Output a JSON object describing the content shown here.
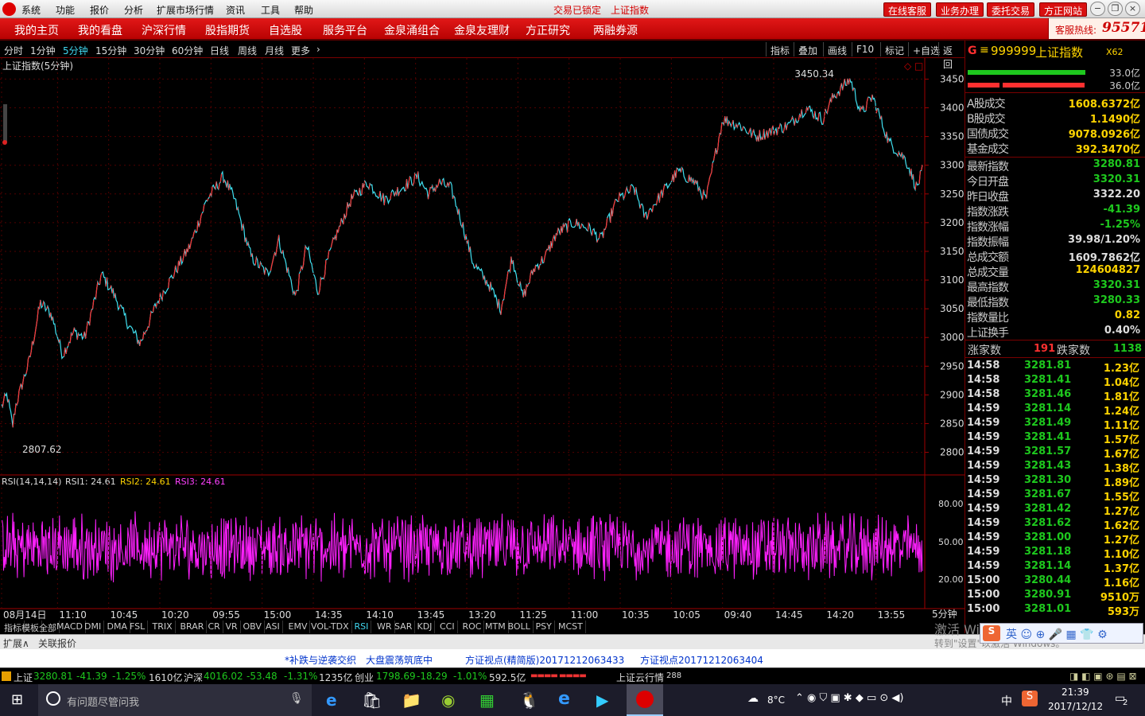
{
  "titlebar": {
    "menus": [
      "系统",
      "功能",
      "报价",
      "分析",
      "扩展市场行情",
      "资讯",
      "工具",
      "帮助"
    ],
    "trade_status": "交易已锁定",
    "index_name": "上证指数",
    "buttons": [
      "在线客服",
      "业务办理",
      "委托交易",
      "方正网站"
    ]
  },
  "nav": {
    "items": [
      "我的主页",
      "我的看盘",
      "沪深行情",
      "股指期货",
      "自选股",
      "服务平台",
      "金泉涌组合",
      "金泉友理财",
      "方正研究",
      "两融券源"
    ],
    "hotline_label": "客服热线:",
    "hotline_number": "95571"
  },
  "period": {
    "items": [
      "分时",
      "1分钟",
      "5分钟",
      "15分钟",
      "30分钟",
      "60分钟",
      "日线",
      "周线",
      "月线",
      "更多"
    ],
    "active": "5分钟",
    "tools": [
      "指标",
      "叠加",
      "画线",
      "F10",
      "标记",
      "+自选",
      "返回"
    ]
  },
  "chart": {
    "title": "上证指数(5分钟)",
    "high_label": "3450.34",
    "low_label": "2807.62",
    "accent_up": "#ff3030",
    "accent_line": "#40e0f0"
  },
  "chart_data": {
    "type": "line",
    "title": "上证指数(5分钟)",
    "ylim": [
      2780,
      3470
    ],
    "yticks": [
      3450,
      3400,
      3350,
      3300,
      3250,
      3200,
      3150,
      3100,
      3050,
      3000,
      2950,
      2900,
      2850,
      2800
    ],
    "xticks": [
      "08月14日",
      "11:10",
      "10:45",
      "10:20",
      "09:55",
      "15:00",
      "14:35",
      "14:10",
      "13:45",
      "13:20",
      "11:25",
      "11:00",
      "10:35",
      "10:05",
      "09:40",
      "14:45",
      "14:20",
      "13:55"
    ],
    "x_period": "5分钟",
    "anchors": [
      [
        0,
        2880
      ],
      [
        2,
        2900
      ],
      [
        4,
        2845
      ],
      [
        5,
        2880
      ],
      [
        10,
        2960
      ],
      [
        14,
        3060
      ],
      [
        18,
        3040
      ],
      [
        22,
        2970
      ],
      [
        26,
        3010
      ],
      [
        30,
        3000
      ],
      [
        36,
        3110
      ],
      [
        40,
        3080
      ],
      [
        46,
        3020
      ],
      [
        50,
        2990
      ],
      [
        56,
        3060
      ],
      [
        62,
        3110
      ],
      [
        68,
        3160
      ],
      [
        74,
        3240
      ],
      [
        80,
        3280
      ],
      [
        84,
        3240
      ],
      [
        90,
        3140
      ],
      [
        96,
        3110
      ],
      [
        100,
        3170
      ],
      [
        106,
        3070
      ],
      [
        110,
        3160
      ],
      [
        114,
        3080
      ],
      [
        120,
        3170
      ],
      [
        126,
        3240
      ],
      [
        132,
        3270
      ],
      [
        138,
        3240
      ],
      [
        144,
        3260
      ],
      [
        150,
        3280
      ],
      [
        154,
        3250
      ],
      [
        158,
        3270
      ],
      [
        162,
        3260
      ],
      [
        166,
        3200
      ],
      [
        170,
        3130
      ],
      [
        176,
        3090
      ],
      [
        180,
        3050
      ],
      [
        184,
        3140
      ],
      [
        188,
        3070
      ],
      [
        192,
        3120
      ],
      [
        196,
        3140
      ],
      [
        200,
        3180
      ],
      [
        206,
        3200
      ],
      [
        212,
        3190
      ],
      [
        216,
        3170
      ],
      [
        222,
        3240
      ],
      [
        228,
        3260
      ],
      [
        232,
        3210
      ],
      [
        238,
        3250
      ],
      [
        244,
        3290
      ],
      [
        250,
        3270
      ],
      [
        254,
        3240
      ],
      [
        260,
        3380
      ],
      [
        266,
        3370
      ],
      [
        272,
        3350
      ],
      [
        278,
        3360
      ],
      [
        284,
        3370
      ],
      [
        290,
        3400
      ],
      [
        296,
        3380
      ],
      [
        300,
        3420
      ],
      [
        306,
        3450
      ],
      [
        310,
        3390
      ],
      [
        314,
        3420
      ],
      [
        320,
        3340
      ],
      [
        326,
        3310
      ],
      [
        330,
        3260
      ],
      [
        332,
        3290
      ]
    ],
    "series": [
      {
        "name": "RSI1",
        "value": 24.61
      },
      {
        "name": "RSI2",
        "value": 24.61
      },
      {
        "name": "RSI3",
        "value": 24.61
      }
    ],
    "rsi_ylim": [
      0,
      100
    ],
    "rsi_yticks": [
      80,
      50,
      20
    ]
  },
  "rsi": {
    "label": "RSI(14,14,14)",
    "r1": "RSI1: 24.61",
    "r2": "RSI2: 24.61",
    "r3": "RSI3: 24.61",
    "tick80": "80.00",
    "tick50": "50.00",
    "tick20": "20.00"
  },
  "rpanel": {
    "marker": "G",
    "code": "999999",
    "name": "上证指数",
    "tag": "X62",
    "bar1": "33.0亿",
    "bar2": "36.0亿",
    "vols": [
      [
        "A股成交",
        "1608.6372亿"
      ],
      [
        "B股成交",
        "1.1490亿"
      ],
      [
        "国债成交",
        "9078.0926亿"
      ],
      [
        "基金成交",
        "392.3470亿"
      ]
    ],
    "stats": [
      [
        "最新指数",
        "3280.81",
        "#1ec81e"
      ],
      [
        "今日开盘",
        "3320.31",
        "#1ec81e"
      ],
      [
        "昨日收盘",
        "3322.20",
        "#ddd"
      ],
      [
        "指数涨跌",
        "-41.39",
        "#1ec81e"
      ],
      [
        "指数涨幅",
        "-1.25%",
        "#1ec81e"
      ],
      [
        "指数振幅",
        "39.98/1.20%",
        "#ddd"
      ],
      [
        "总成交额",
        "1609.7862亿",
        "#ddd"
      ],
      [
        "总成交量",
        "124604827",
        "#ffd400"
      ],
      [
        "最高指数",
        "3320.31",
        "#1ec81e"
      ],
      [
        "最低指数",
        "3280.33",
        "#1ec81e"
      ],
      [
        "指数量比",
        "0.82",
        "#ffd400"
      ],
      [
        "上证换手",
        "0.40%",
        "#ddd"
      ]
    ],
    "up_label": "涨家数",
    "up": "191",
    "down_label": "跌家数",
    "down": "1138",
    "ticks": [
      [
        "14:58",
        "3281.81",
        "1.23亿"
      ],
      [
        "14:58",
        "3281.41",
        "1.04亿"
      ],
      [
        "14:58",
        "3281.46",
        "1.81亿"
      ],
      [
        "14:59",
        "3281.14",
        "1.24亿"
      ],
      [
        "14:59",
        "3281.49",
        "1.11亿"
      ],
      [
        "14:59",
        "3281.41",
        "1.57亿"
      ],
      [
        "14:59",
        "3281.57",
        "1.67亿"
      ],
      [
        "14:59",
        "3281.43",
        "1.38亿"
      ],
      [
        "14:59",
        "3281.30",
        "1.89亿"
      ],
      [
        "14:59",
        "3281.67",
        "1.55亿"
      ],
      [
        "14:59",
        "3281.42",
        "1.27亿"
      ],
      [
        "14:59",
        "3281.62",
        "1.62亿"
      ],
      [
        "14:59",
        "3281.00",
        "1.27亿"
      ],
      [
        "14:59",
        "3281.18",
        "1.10亿"
      ],
      [
        "14:59",
        "3281.14",
        "1.37亿"
      ],
      [
        "15:00",
        "3280.44",
        "1.16亿"
      ],
      [
        "15:00",
        "3280.91",
        "9510万"
      ],
      [
        "15:00",
        "3281.01",
        "593万"
      ]
    ]
  },
  "tabs": [
    "指标",
    "模板",
    "全部",
    "MACD",
    "DMI",
    "DMA",
    "FSL",
    "TRIX",
    "BRAR",
    "CR",
    "VR",
    "OBV",
    "ASI",
    "EMV",
    "VOL-TDX",
    "RSI",
    "WR",
    "SAR",
    "KDJ",
    "CCI",
    "ROC",
    "MTM",
    "BOLL",
    "PSY",
    "MCST"
  ],
  "bottom": {
    "expand": "扩展∧",
    "related": "关联报价",
    "news": [
      "*补跌与逆袭交织",
      "大盘震荡筑底中",
      "方证视点(精简版)20171212063433",
      "方证视点20171212063404"
    ],
    "sh_label": "上证",
    "sh": "3280.81",
    "sh_chg": "-41.39",
    "sh_pct": "-1.25%",
    "sh_amt": "1610亿",
    "hs_label": "沪深",
    "hs": "4016.02",
    "hs_chg": "-53.48",
    "hs_pct": "-1.31%",
    "hs_amt": "1235亿",
    "cy_label": "创业",
    "cy": "1798.69",
    "cy_chg": "-18.29",
    "cy_pct": "-1.01%",
    "cy_amt": "592.5亿",
    "cloud": "上证云行情",
    "cloud_no": "288",
    "watermark1": "激活 Windows",
    "watermark2": "转到\"设置\"以激活 Windows。"
  },
  "taskbar": {
    "search": "有问题尽管问我",
    "temp": "8°C",
    "ime": "中",
    "time": "21:39",
    "date": "2017/12/12",
    "notif": "2"
  }
}
